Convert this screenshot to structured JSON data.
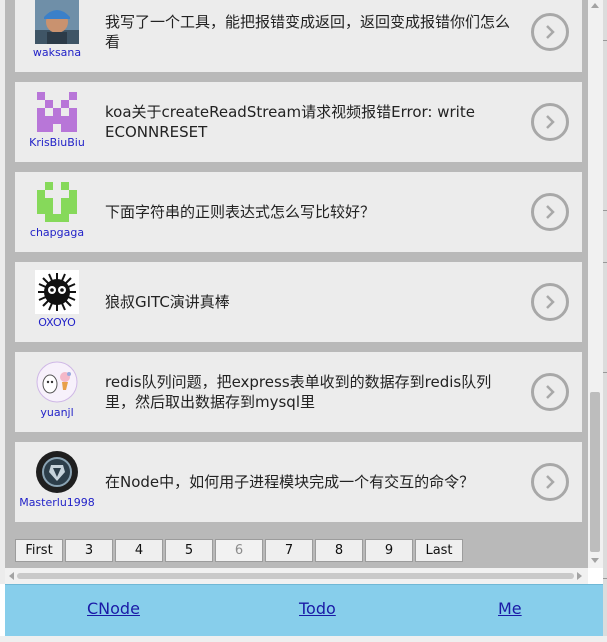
{
  "topics": [
    {
      "author": "waksana",
      "title": "我写了一个工具，能把报错变成返回，返回变成报错你们怎么看",
      "avatar_icon": "photo-avatar"
    },
    {
      "author": "KrisBiuBiu",
      "title": "koa关于createReadStream请求视频报错Error: write ECONNRESET",
      "avatar_icon": "purple-identicon"
    },
    {
      "author": "chapgaga",
      "title": "下面字符串的正则表达式怎么写比较好？",
      "avatar_icon": "green-identicon"
    },
    {
      "author": "OXOYO",
      "title": "狼叔GITC演讲真棒",
      "avatar_icon": "black-furball-avatar"
    },
    {
      "author": "yuanjl",
      "title": "redis队列问题，把express表单收到的数据存到redis队列里，然后取出数据存到mysql里",
      "avatar_icon": "cartoon-avatar"
    },
    {
      "author": "Masterlu1998",
      "title": "在Node中，如何用子进程模块完成一个有交互的命令？",
      "avatar_icon": "shield-logo-avatar"
    }
  ],
  "pagination": {
    "buttons": [
      "First",
      "3",
      "4",
      "5",
      "6",
      "7",
      "8",
      "9",
      "Last"
    ],
    "current": "6"
  },
  "nav": {
    "links": [
      "CNode",
      "Todo",
      "Me"
    ]
  },
  "colors": {
    "list_background": "#b9b9b9",
    "card_background": "#ececec",
    "author_link": "#2323c8",
    "nav_background": "#87ceeb",
    "nav_link": "#1a1aa6"
  }
}
